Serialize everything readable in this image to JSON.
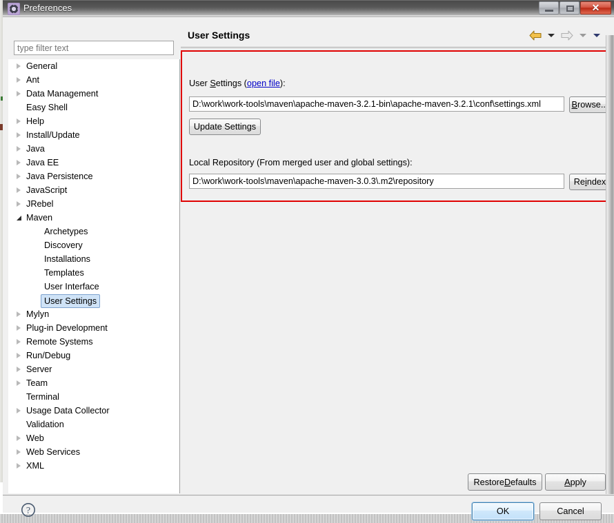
{
  "window": {
    "title": "Preferences",
    "icon": "gear-icon",
    "buttons": {
      "minimize": "minimize-icon",
      "maximize": "restore-icon",
      "close": "✕"
    }
  },
  "sidebar": {
    "filter": {
      "value": "",
      "placeholder": "type filter text"
    },
    "items": [
      {
        "label": "General",
        "expandable": true,
        "expanded": false,
        "indent": 0,
        "selected": false
      },
      {
        "label": "Ant",
        "expandable": true,
        "expanded": false,
        "indent": 0,
        "selected": false
      },
      {
        "label": "Data Management",
        "expandable": true,
        "expanded": false,
        "indent": 0,
        "selected": false
      },
      {
        "label": "Easy Shell",
        "expandable": false,
        "expanded": false,
        "indent": 0,
        "selected": false
      },
      {
        "label": "Help",
        "expandable": true,
        "expanded": false,
        "indent": 0,
        "selected": false
      },
      {
        "label": "Install/Update",
        "expandable": true,
        "expanded": false,
        "indent": 0,
        "selected": false
      },
      {
        "label": "Java",
        "expandable": true,
        "expanded": false,
        "indent": 0,
        "selected": false
      },
      {
        "label": "Java EE",
        "expandable": true,
        "expanded": false,
        "indent": 0,
        "selected": false
      },
      {
        "label": "Java Persistence",
        "expandable": true,
        "expanded": false,
        "indent": 0,
        "selected": false
      },
      {
        "label": "JavaScript",
        "expandable": true,
        "expanded": false,
        "indent": 0,
        "selected": false
      },
      {
        "label": "JRebel",
        "expandable": true,
        "expanded": false,
        "indent": 0,
        "selected": false
      },
      {
        "label": "Maven",
        "expandable": true,
        "expanded": true,
        "indent": 0,
        "selected": false
      },
      {
        "label": "Archetypes",
        "expandable": false,
        "expanded": false,
        "indent": 1,
        "selected": false
      },
      {
        "label": "Discovery",
        "expandable": false,
        "expanded": false,
        "indent": 1,
        "selected": false
      },
      {
        "label": "Installations",
        "expandable": false,
        "expanded": false,
        "indent": 1,
        "selected": false
      },
      {
        "label": "Templates",
        "expandable": false,
        "expanded": false,
        "indent": 1,
        "selected": false
      },
      {
        "label": "User Interface",
        "expandable": false,
        "expanded": false,
        "indent": 1,
        "selected": false
      },
      {
        "label": "User Settings",
        "expandable": false,
        "expanded": false,
        "indent": 1,
        "selected": true
      },
      {
        "label": "Mylyn",
        "expandable": true,
        "expanded": false,
        "indent": 0,
        "selected": false
      },
      {
        "label": "Plug-in Development",
        "expandable": true,
        "expanded": false,
        "indent": 0,
        "selected": false
      },
      {
        "label": "Remote Systems",
        "expandable": true,
        "expanded": false,
        "indent": 0,
        "selected": false
      },
      {
        "label": "Run/Debug",
        "expandable": true,
        "expanded": false,
        "indent": 0,
        "selected": false
      },
      {
        "label": "Server",
        "expandable": true,
        "expanded": false,
        "indent": 0,
        "selected": false
      },
      {
        "label": "Team",
        "expandable": true,
        "expanded": false,
        "indent": 0,
        "selected": false
      },
      {
        "label": "Terminal",
        "expandable": false,
        "expanded": false,
        "indent": 0,
        "selected": false
      },
      {
        "label": "Usage Data Collector",
        "expandable": true,
        "expanded": false,
        "indent": 0,
        "selected": false
      },
      {
        "label": "Validation",
        "expandable": false,
        "expanded": false,
        "indent": 0,
        "selected": false
      },
      {
        "label": "Web",
        "expandable": true,
        "expanded": false,
        "indent": 0,
        "selected": false
      },
      {
        "label": "Web Services",
        "expandable": true,
        "expanded": false,
        "indent": 0,
        "selected": false
      },
      {
        "label": "XML",
        "expandable": true,
        "expanded": false,
        "indent": 0,
        "selected": false
      }
    ]
  },
  "page": {
    "title": "User Settings",
    "nav": {
      "back_icon": "back-arrow-icon",
      "back_caret": "chevron-down-icon",
      "forward_icon": "forward-arrow-icon",
      "forward_caret": "chevron-down-icon",
      "menu_caret": "chevron-down-icon"
    },
    "user_settings": {
      "label_pre": "User ",
      "label_mnemonic": "S",
      "label_post": "ettings (",
      "link": "open file",
      "label_end": "):",
      "path_value": "D:\\work\\work-tools\\maven\\apache-maven-3.2.1-bin\\apache-maven-3.2.1\\conf\\settings.xml",
      "browse_pre": "",
      "browse_mnemonic": "B",
      "browse_post": "rowse...",
      "update_button": "Update Settings"
    },
    "local_repository": {
      "label": "Local Repository (From merged user and global settings):",
      "path_value": "D:\\work\\work-tools\\maven\\apache-maven-3.0.3\\.m2\\repository",
      "reindex_pre": "Re",
      "reindex_mnemonic": "i",
      "reindex_post": "ndex"
    },
    "restore_defaults": {
      "pre": "Restore ",
      "mnemonic": "D",
      "post": "efaults"
    },
    "apply": {
      "pre": "",
      "mnemonic": "A",
      "post": "pply"
    }
  },
  "footer": {
    "help_icon": "help-question-icon",
    "ok": "OK",
    "cancel": "Cancel"
  },
  "colors": {
    "annotation_red": "#e00000",
    "link_blue": "#0000c8",
    "selection_blue": "#cfe3f7",
    "dialog_bg": "#f0f0f0",
    "tree_bg": "#ffffff"
  }
}
